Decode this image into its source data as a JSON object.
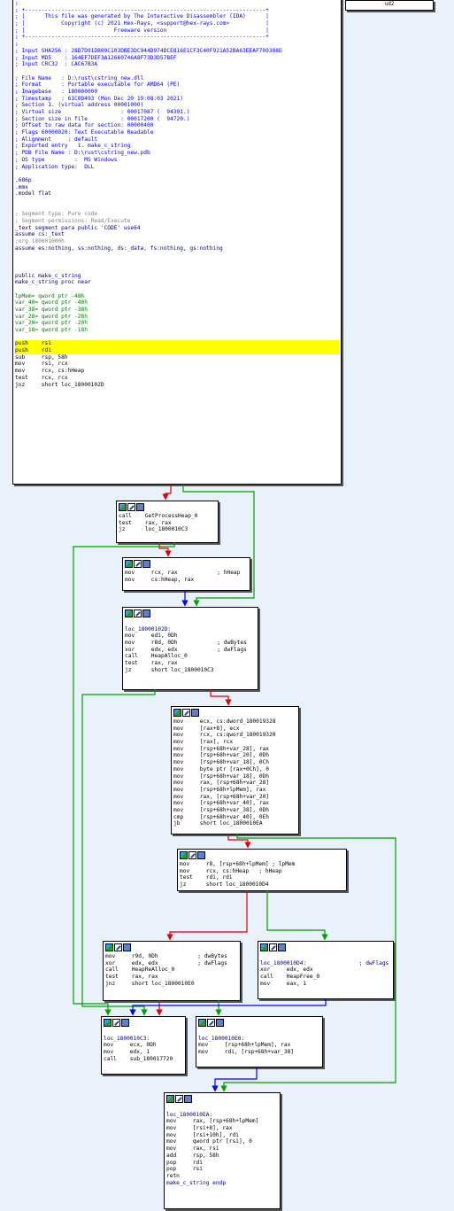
{
  "top_stub": {
    "text": "ud2"
  },
  "header_block": {
    "lines": [
      ";",
      "; +-------------------------------------------------------------------------+",
      "; |      This file was generated by The Interactive Disassembler (IDA)      |",
      "; |           Copyright (c) 2021 Hex-Rays, <support@hex-rays.com>           |",
      "; |                           Freeware version                              |",
      "; +-------------------------------------------------------------------------+",
      ";",
      "; Input SHA256 : 28D7D91DB09C103DBE3DC944D974DCE816E1CF3C40F921A52BA63EEAF709308D",
      "; Input MD5    : 164EF7DEF3A12660746A8F73D3D57BEF",
      "; Input CRC32  : CAC67B3A",
      "",
      "; File Name   : D:\\rust\\cstring_new.dll",
      "; Format      : Portable executable for AMD64 (PE)",
      "; Imagebase   : 180000000",
      "; Timestamp   : 61C0D493 (Mon Dec 20 19:08:03 2021)",
      "; Section 1. (virtual address 00001000)",
      "; Virtual size                  : 00017087 (  94391.)",
      "; Section size in file          : 00017200 (  94720.)",
      "; Offset to raw data for section: 00000400",
      "; Flags 60000020: Text Executable Readable",
      "; Alignment     : default",
      "; Exported entry   1. make_c_string",
      "; PDB File Name : D:\\rust\\cstring_new.pdb",
      "; OS type         :  MS Windows",
      "; Application type:  DLL",
      "",
      ".686p",
      ".mmx",
      ".model flat",
      "",
      "",
      "; Segment type: Pure code",
      "; Segment permissions: Read/Execute",
      "_text segment para public 'CODE' use64",
      "assume cs:_text",
      ";org 180001000h",
      "assume es:nothing, ss:nothing, ds:_data, fs:nothing, gs:nothing",
      "",
      "",
      "",
      "public make_c_string",
      "make_c_string proc near",
      "",
      "lpMem= qword ptr -48h",
      "var_40= qword ptr -40h",
      "var_38= qword ptr -38h",
      "var_28= qword ptr -28h",
      "var_20= qword ptr -20h",
      "var_18= qword ptr -18h",
      "",
      "push    rsi",
      "push    rdi",
      "sub     rsp, 58h",
      "mov     rsi, rcx",
      "mov     rcx, cs:hHeap",
      "test    rcx, rcx",
      "jnz     short loc_18000102D"
    ]
  },
  "blocks": {
    "b1": [
      "call    GetProcessHeap_0",
      "test    rax, rax",
      "jz      loc_1800010C3"
    ],
    "b2": [
      "mov     rcx, rax            ; hHeap",
      "mov     cs:hHeap, rax"
    ],
    "b3": [
      "",
      "loc_18000102D:",
      "mov     edi, 0Dh",
      "mov     r8d, 0Dh            ; dwBytes",
      "xor     edx, edx            ; dwFlags",
      "call    HeapAlloc_0",
      "test    rax, rax",
      "jz      short loc_1800010C3"
    ],
    "b4": [
      "mov     ecx, cs:dword_180019328",
      "mov     [rax+8], ecx",
      "mov     rcx, cs:qword_180019320",
      "mov     [rax], rcx",
      "mov     [rsp+68h+var_28], rax",
      "mov     [rsp+68h+var_20], 0Dh",
      "mov     [rsp+68h+var_18], 0Ch",
      "mov     byte ptr [rax+0Ch], 0",
      "mov     [rsp+68h+var_18], 0Dh",
      "mov     rax, [rsp+68h+var_28]",
      "mov     [rsp+68h+lpMem], rax",
      "mov     rax, [rsp+68h+var_20]",
      "mov     [rsp+68h+var_40], rax",
      "mov     [rsp+68h+var_38], 0Dh",
      "cmp     [rsp+68h+var_40], 0Eh",
      "jb      short loc_1800010EA"
    ],
    "b5": [
      "mov     r8, [rsp+68h+lpMem] ; lpMem",
      "mov     rcx, cs:hHeap   ; hHeap",
      "test    rdi, rdi",
      "jz      short loc_1800010D4"
    ],
    "b6": [
      "mov     r9d, 0Dh            ; dwBytes",
      "xor     edx, edx            ; dwFlags",
      "call    HeapReAlloc_0",
      "test    rax, rax",
      "jnz     short loc_1800010E0"
    ],
    "b7": [
      "",
      "loc_1800010D4:                ; dwFlags",
      "xor     edx, edx",
      "call    HeapFree_0",
      "mov     eax, 1"
    ],
    "b8": [
      "",
      "loc_1800010C3:",
      "mov     ecx, 0Dh",
      "mov     edx, 1",
      "call    sub_180017720"
    ],
    "b9": [
      "",
      "loc_1800010E0:",
      "mov     [rsp+68h+lpMem], rax",
      "mov     rdi, [rsp+68h+var_38]"
    ],
    "b10": [
      "",
      "loc_1800010EA:",
      "mov     rax, [rsp+68h+lpMem]",
      "mov     [rsi+8], rax",
      "mov     [rsi+10h], rdi",
      "mov     qword ptr [rsi], 0",
      "mov     rax, rsi",
      "add     rsp, 58h",
      "pop     rdi",
      "pop     rsi",
      "retn",
      "make_c_string endp"
    ]
  },
  "colors": {
    "background": "#e9f1fb",
    "edge_true": "#00a000",
    "edge_false": "#e00000",
    "edge_uncond": "#0000ff"
  }
}
